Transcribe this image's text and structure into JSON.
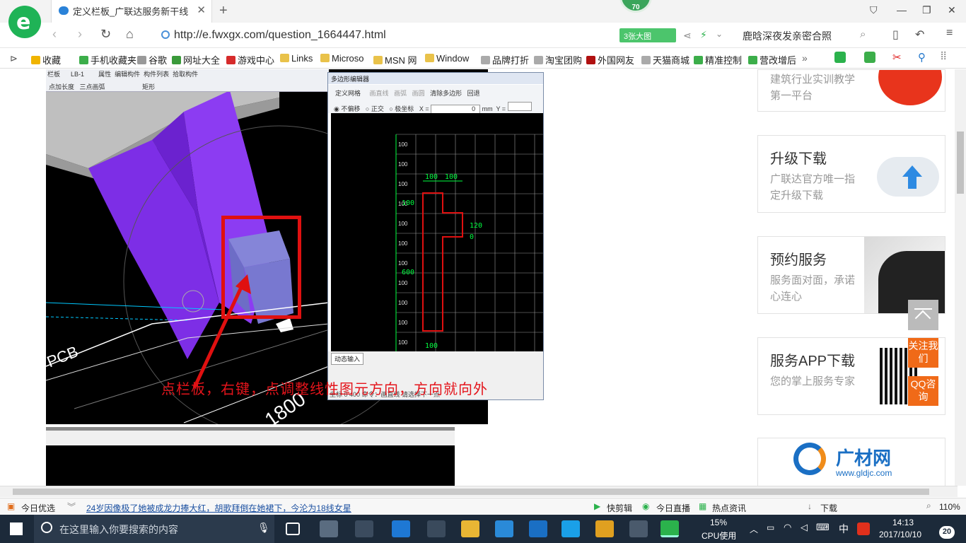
{
  "browser": {
    "tab_title": "定义栏板_广联达服务新干线",
    "badge": "70",
    "url": "http://e.fwxgx.com/question_1664447.html",
    "big_image_btn": "3张大图",
    "search_hint": "鹿晗深夜发亲密合照"
  },
  "bookmarks": [
    {
      "label": "收藏",
      "color": "#f0b400"
    },
    {
      "label": "手机收藏夹",
      "color": "#3cae4a"
    },
    {
      "label": "谷歌",
      "color": "#999999"
    },
    {
      "label": "网址大全",
      "color": "#3a9a3a"
    },
    {
      "label": "游戏中心",
      "color": "#d62b2b"
    },
    {
      "label": "Links",
      "color": "#e9c24a"
    },
    {
      "label": "Microso",
      "color": "#e9c24a"
    },
    {
      "label": "MSN 网",
      "color": "#e9c24a"
    },
    {
      "label": "Window",
      "color": "#e9c24a"
    },
    {
      "label": "品牌打折",
      "color": "#aaaaaa"
    },
    {
      "label": "淘宝团购",
      "color": "#aaaaaa"
    },
    {
      "label": "外国网友",
      "color": "#b01010"
    },
    {
      "label": "天猫商城",
      "color": "#aaaaaa"
    },
    {
      "label": "精准控制",
      "color": "#3cae4a"
    },
    {
      "label": "营改增后",
      "color": "#3cae4a"
    }
  ],
  "cad": {
    "annotation": "点栏板，右键，点调整线性图元方向，方向就向外",
    "pcb_label": "PCB",
    "dim_label": "1800",
    "toolbar_row1": [
      "栏板",
      "LB-1",
      "属性",
      "编辑构件",
      "构件列表",
      "拾取构件"
    ],
    "toolbar_row2": [
      "点加长度",
      "三点画弧",
      "矩形"
    ],
    "poly_editor": {
      "title": "多边形编辑器",
      "tools": [
        "定义网格",
        "画直线",
        "画弧",
        "画圆",
        "清除多边形",
        "回退"
      ],
      "options": [
        "不偏移",
        "正交",
        "极坐标"
      ],
      "x_label": "X =",
      "x_value": "0",
      "unit": "mm",
      "y_label": "Y =",
      "grid_label": "100",
      "dims": {
        "top1": "100",
        "top2": "100",
        "left1": "100",
        "right": "120",
        "zero": "0",
        "left_big": "600",
        "bottom": "100"
      },
      "dynamic_input": "动态输入",
      "status": "坐标  0  400   命令：画直线      请选择下一点"
    }
  },
  "sidebar": {
    "cards": [
      {
        "title": "",
        "desc": "建筑行业实训教学第一平台"
      },
      {
        "title": "升级下载",
        "desc": "广联达官方唯一指定升级下载"
      },
      {
        "title": "预约服务",
        "desc": "服务面对面，承诺心连心"
      },
      {
        "title": "服务APP下载",
        "desc": "您的掌上服务专家"
      },
      {
        "title": "广材网",
        "desc": "www.gldjc.com"
      }
    ],
    "float_follow": "关注我们",
    "float_qq": "QQ咨询"
  },
  "statusbar": {
    "today_pick": "今日优选",
    "news": "24岁因像极了她被成龙力捧大红，胡歌拜倒在她裙下，今沦为18线女星",
    "items": [
      "快剪辑",
      "今日直播",
      "热点资讯",
      "下载"
    ],
    "zoom": "110%"
  },
  "taskbar": {
    "search_placeholder": "在这里输入你要搜索的内容",
    "cpu": "15%",
    "cpu_label": "CPU使用",
    "ime": "中",
    "time": "14:13",
    "date": "2017/10/10",
    "notif": "20"
  }
}
